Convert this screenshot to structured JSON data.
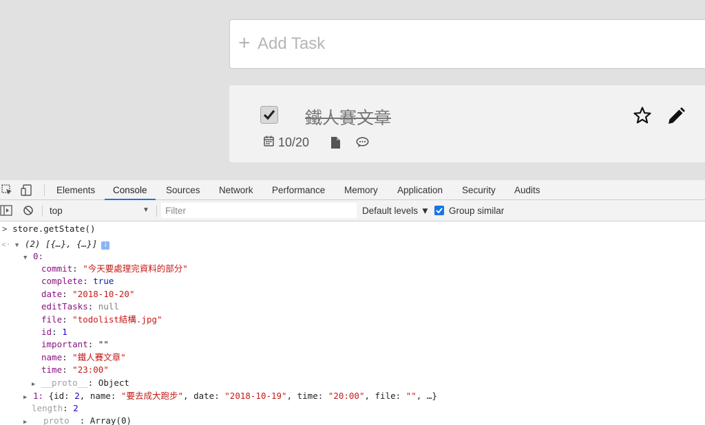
{
  "app": {
    "add_task_placeholder": "Add Task",
    "task": {
      "name": "鐵人賽文章",
      "date": "10/20",
      "completed": true,
      "icons": [
        "calendar-icon",
        "file-icon",
        "comment-icon",
        "star-icon",
        "pencil-icon"
      ]
    }
  },
  "devtools": {
    "tabs": [
      "Elements",
      "Console",
      "Sources",
      "Network",
      "Performance",
      "Memory",
      "Application",
      "Security",
      "Audits"
    ],
    "active_tab": "Console",
    "context": "top",
    "filter_placeholder": "Filter",
    "levels": "Default levels ▼",
    "group_similar": "Group similar",
    "accent": "#1a73e8"
  },
  "console": {
    "input": "store.getState()",
    "result_summary": "(2) [{…}, {…}]",
    "item0_label": "0:",
    "item0": [
      {
        "key": "commit",
        "value": "\"今天要處理完資料的部分\"",
        "type": "string"
      },
      {
        "key": "complete",
        "value": "true",
        "type": "bool"
      },
      {
        "key": "date",
        "value": "\"2018-10-20\"",
        "type": "string"
      },
      {
        "key": "editTasks",
        "value": "null",
        "type": "null"
      },
      {
        "key": "file",
        "value": "\"todolist結構.jpg\"",
        "type": "string"
      },
      {
        "key": "id",
        "value": "1",
        "type": "number"
      },
      {
        "key": "important",
        "value": "\"\"",
        "type": "plain"
      },
      {
        "key": "name",
        "value": "\"鐵人賽文章\"",
        "type": "string"
      },
      {
        "key": "time",
        "value": "\"23:00\"",
        "type": "string"
      }
    ],
    "item0_proto_key": "__proto__",
    "item0_proto_val": "Object",
    "item1": {
      "label": "1:",
      "open": "{id: ",
      "id": "2",
      "sep1": ", name: ",
      "name": "\"要去成大跑步\"",
      "sep2": ", date: ",
      "date": "\"2018-10-19\"",
      "sep3": ", time: ",
      "time": "\"20:00\"",
      "sep4": ", file: ",
      "file": "\"\"",
      "close": ", …}"
    },
    "length_key": "length",
    "length_val": "2",
    "proto_key": "__proto__",
    "proto_val": "Array(0)"
  }
}
